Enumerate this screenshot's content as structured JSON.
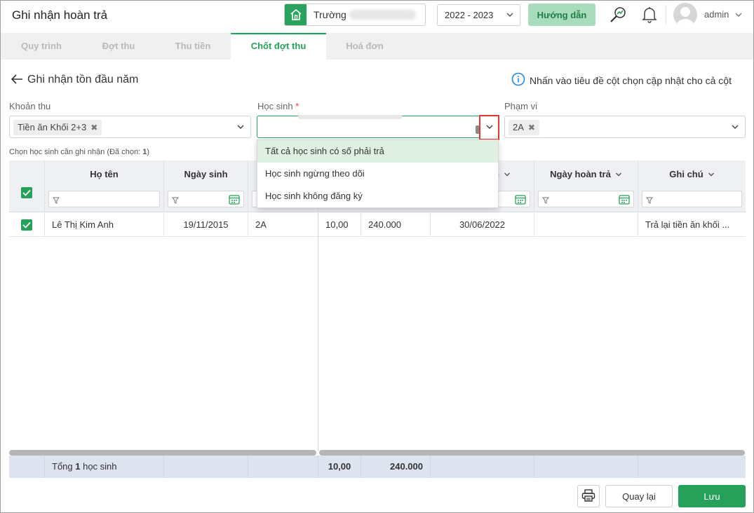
{
  "header": {
    "title": "Ghi nhận hoàn trả",
    "school_label": "Trường",
    "year": "2022 - 2023",
    "guide_label": "Hướng dẫn",
    "user": "admin"
  },
  "tabs": [
    {
      "label": "Quy trình"
    },
    {
      "label": "Đợt thu"
    },
    {
      "label": "Thu tiền"
    },
    {
      "label": "Chốt đợt thu",
      "active": true
    },
    {
      "label": "Hoá đơn"
    }
  ],
  "page": {
    "back_title": "Ghi nhận tồn đầu năm",
    "hint": "Nhấn vào tiêu đề cột chọn cập nhật cho cả cột"
  },
  "filters": {
    "khoan_thu": {
      "label": "Khoản thu",
      "tag": "Tiền ăn Khối 2+3"
    },
    "hoc_sinh": {
      "label": "Học sinh",
      "required": "*"
    },
    "pham_vi": {
      "label": "Phạm vi",
      "tag": "2A"
    }
  },
  "dropdown": {
    "options": [
      "Tất cả học sinh có số phải trả",
      "Học sinh ngừng theo dõi",
      "Học sinh không đăng ký"
    ],
    "selected_index": 0
  },
  "selection_note": {
    "prefix": "Chọn học sinh cần ghi nhận (Đã chọn: ",
    "count": "1",
    "suffix": ")"
  },
  "table": {
    "columns": {
      "ho_ten": "Họ tên",
      "ngay_sinh": "Ngày sinh",
      "partial": "n",
      "ngay_hoan_tra": "Ngày hoàn trả",
      "ghi_chu": "Ghi chú"
    },
    "rows": [
      {
        "ho_ten": "Lê Thị Kim Anh",
        "ngay_sinh": "19/11/2015",
        "lop": "2A",
        "so_luong": "10,00",
        "so_tien": "240.000",
        "ngay": "30/06/2022",
        "ngay_hoan_tra": "",
        "ghi_chu": "Trả lại tiền ăn khối ..."
      }
    ],
    "footer": {
      "prefix": "Tổng ",
      "count": "1",
      "suffix": " học sinh",
      "so_luong": "10,00",
      "so_tien": "240.000"
    }
  },
  "buttons": {
    "back": "Quay lại",
    "save": "Lưu"
  },
  "colors": {
    "accent": "#26a159",
    "highlight": "#e53935"
  }
}
